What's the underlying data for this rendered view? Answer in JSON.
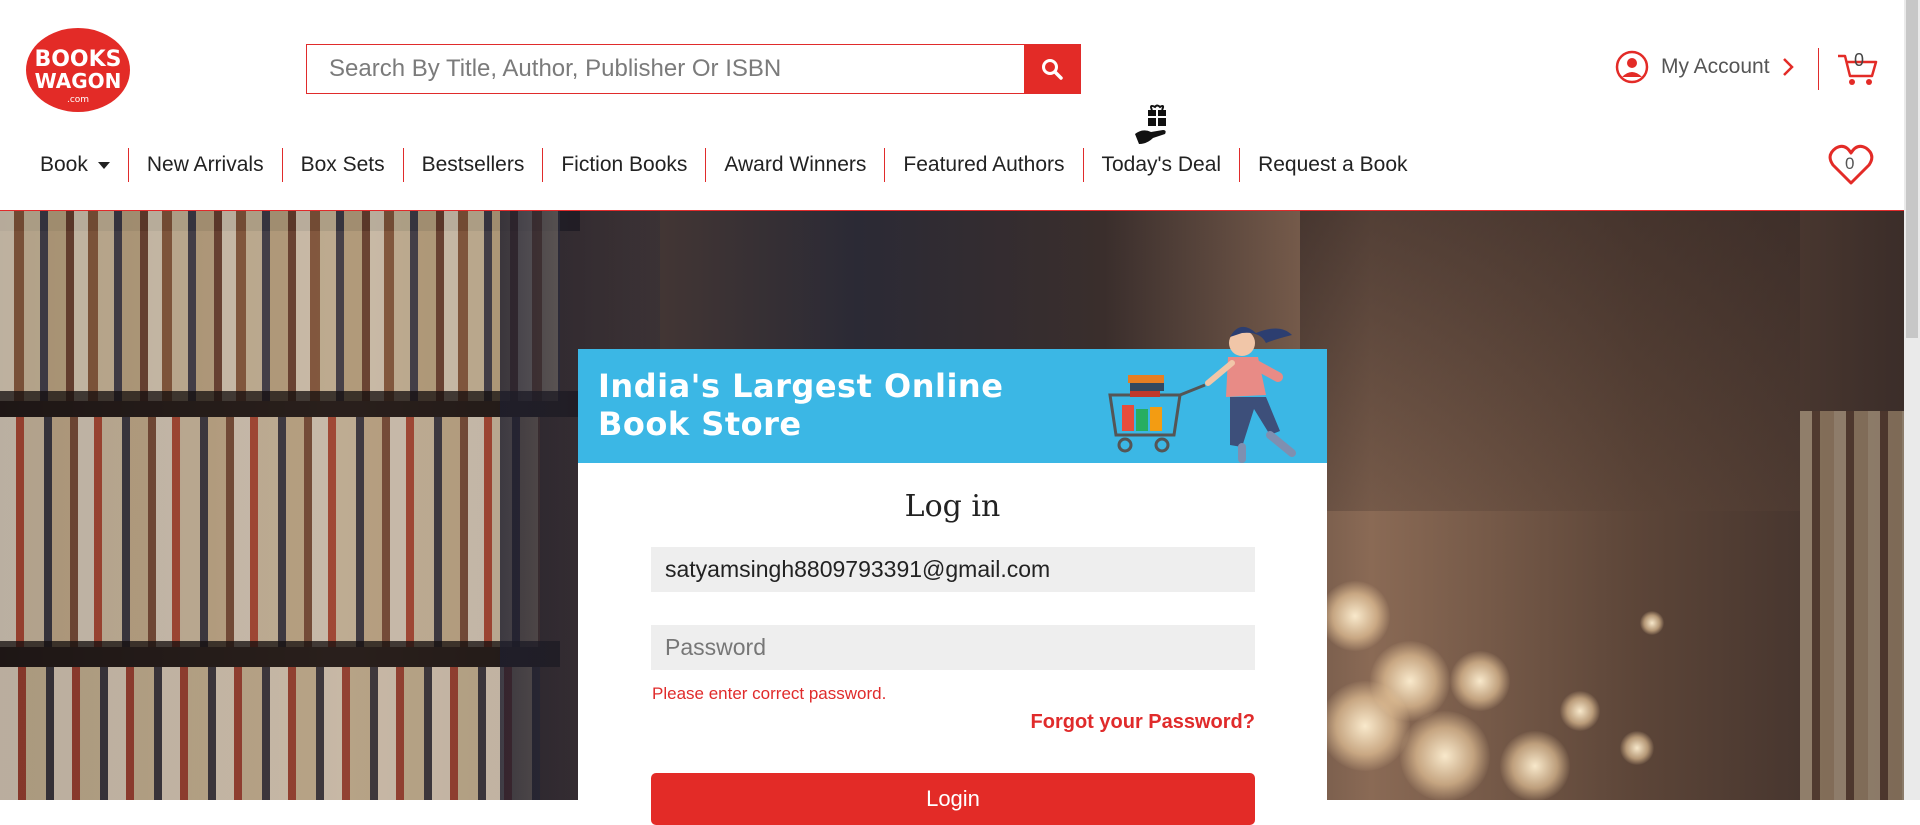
{
  "logo": {
    "top": "BOOKS",
    "bottom": "WAGON",
    "suffix": ".com"
  },
  "search": {
    "placeholder": "Search By Title, Author, Publisher Or ISBN",
    "value": ""
  },
  "account": {
    "label": "My Account"
  },
  "cart": {
    "count": "0"
  },
  "wishlist": {
    "count": "0"
  },
  "nav": {
    "items": [
      {
        "label": "Book"
      },
      {
        "label": "New Arrivals"
      },
      {
        "label": "Box Sets"
      },
      {
        "label": "Bestsellers"
      },
      {
        "label": "Fiction Books"
      },
      {
        "label": "Award Winners"
      },
      {
        "label": "Featured Authors"
      },
      {
        "label": "Today's Deal"
      },
      {
        "label": "Request a Book"
      }
    ]
  },
  "banner": {
    "line1": "India's Largest Online",
    "line2": "Book Store"
  },
  "login": {
    "title": "Log in",
    "email_value": "satyamsingh8809793391@gmail.com",
    "password_placeholder": "Password",
    "error": "Please enter correct password.",
    "forgot": "Forgot your Password?",
    "button": "Login"
  },
  "colors": {
    "brand_red": "#e32b27",
    "banner_blue": "#3bb7e5"
  }
}
